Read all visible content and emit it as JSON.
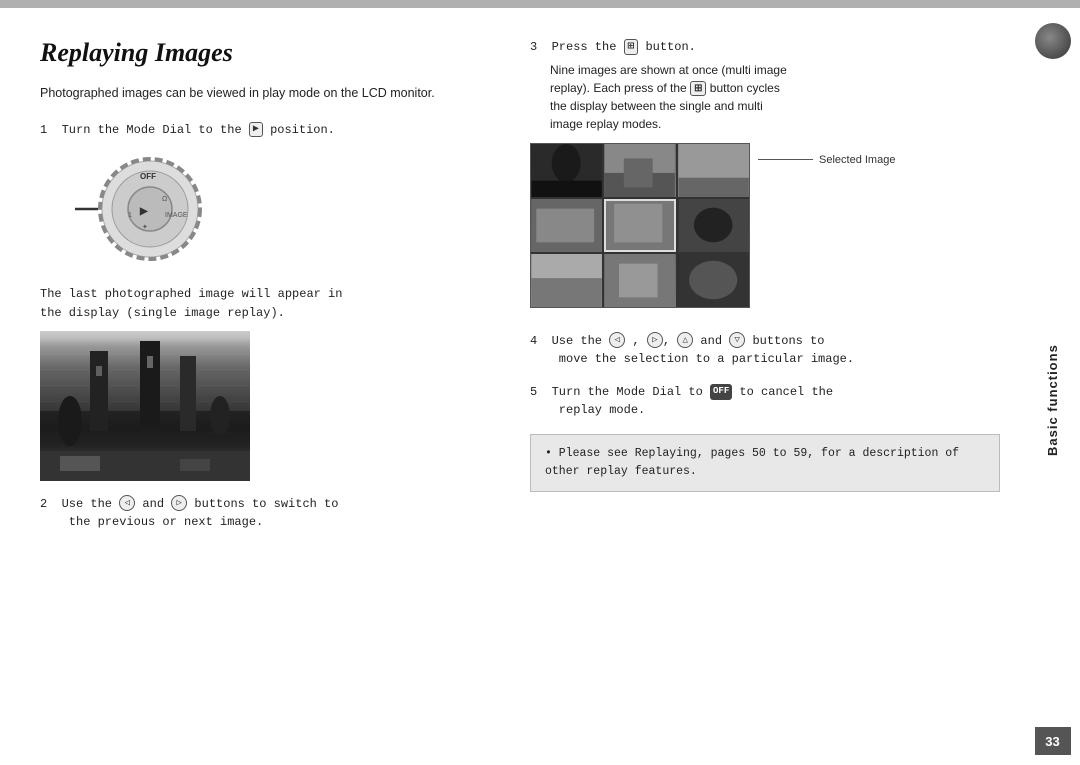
{
  "top_bar": {},
  "sidebar": {
    "label": "Basic functions",
    "page_number": "33"
  },
  "page": {
    "title": "Replaying Images",
    "intro": "Photographed images can be viewed in play mode on the LCD monitor.",
    "steps": [
      {
        "number": "1",
        "text": "Turn the Mode Dial to the ▶ position.",
        "has_dial": true
      },
      {
        "number": "",
        "text": "The last photographed image will appear in the display (single image replay).",
        "has_image": true
      },
      {
        "number": "2",
        "text": "Use the ◁ and ▷ buttons to switch to the previous or next image."
      },
      {
        "number": "3",
        "text": "Press the ⊞ button.",
        "sub": "Nine images are shown at once (multi image replay). Each press of the ⊞ button cycles the display between the single and multi image replay modes.",
        "has_grid": true
      },
      {
        "number": "4",
        "text": "Use the ◁ , ▷, △ and ▽ buttons to move the selection to a particular image."
      },
      {
        "number": "5",
        "text": "Turn the Mode Dial to OFF to cancel the replay mode."
      }
    ],
    "note": "• Please see Replaying, pages 50 to 59, for a description of other replay features.",
    "selected_image_label": "Selected\nImage"
  }
}
